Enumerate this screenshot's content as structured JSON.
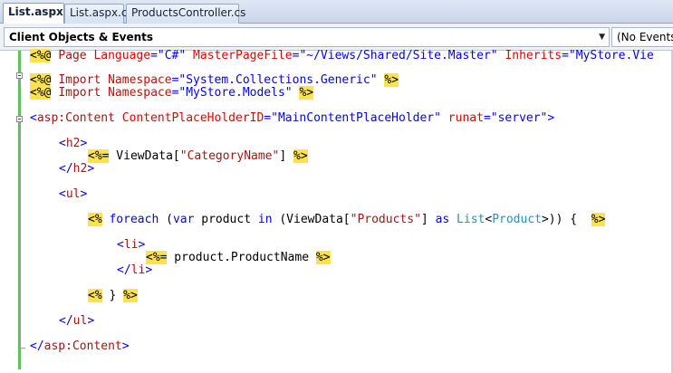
{
  "tabs": [
    {
      "label": "List.aspx",
      "active": true
    },
    {
      "label": "List.aspx.cs",
      "active": false
    },
    {
      "label": "ProductsController.cs",
      "active": false
    }
  ],
  "navbar": {
    "objects_dropdown": "Client Objects & Events",
    "events_dropdown": "(No Events)"
  },
  "colors": {
    "delimiter_highlight": "#fde34b",
    "markup_tag": "#a31515",
    "markup_attribute": "#e50000",
    "string_value": "#0000ff",
    "keyword": "#0000ff",
    "type_name": "#2b91af",
    "change_bar": "#5ec15e"
  },
  "code_lines": [
    [
      [
        "<%@",
        "dl"
      ],
      [
        " ",
        "pl"
      ],
      [
        "Page",
        "tag"
      ],
      [
        " ",
        "pl"
      ],
      [
        "Language",
        "attr"
      ],
      [
        "=\"C#\"",
        "str"
      ],
      [
        " ",
        "pl"
      ],
      [
        "MasterPageFile",
        "attr"
      ],
      [
        "=\"~/Views/Shared/Site.Master\"",
        "str"
      ],
      [
        " ",
        "pl"
      ],
      [
        "Inherits",
        "attr"
      ],
      [
        "=\"MyStore.Vie",
        "str"
      ]
    ],
    [
      [
        "<%@",
        "dl"
      ],
      [
        " ",
        "pl"
      ],
      [
        "Import",
        "tag"
      ],
      [
        " ",
        "pl"
      ],
      [
        "Namespace",
        "attr"
      ],
      [
        "=\"System.Collections.Generic\"",
        "str"
      ],
      [
        " ",
        "pl"
      ],
      [
        "%>",
        "dl"
      ]
    ],
    [
      [
        "<%@",
        "dl"
      ],
      [
        " ",
        "pl"
      ],
      [
        "Import",
        "tag"
      ],
      [
        " ",
        "pl"
      ],
      [
        "Namespace",
        "attr"
      ],
      [
        "=\"MyStore.Models\"",
        "str"
      ],
      [
        " ",
        "pl"
      ],
      [
        "%>",
        "dl"
      ]
    ],
    [
      [
        "<",
        "str"
      ],
      [
        "asp:Content",
        "tag"
      ],
      [
        " ",
        "pl"
      ],
      [
        "ContentPlaceHolderID",
        "attr"
      ],
      [
        "=\"MainContentPlaceHolder\"",
        "str"
      ],
      [
        " ",
        "pl"
      ],
      [
        "runat",
        "attr"
      ],
      [
        "=\"server\"",
        "str"
      ],
      [
        ">",
        "str"
      ]
    ],
    [
      [
        "<",
        "str"
      ],
      [
        "h2",
        "tag"
      ],
      [
        ">",
        "str"
      ]
    ],
    [
      [
        "<%=",
        "dl"
      ],
      [
        " ViewData[",
        "pl"
      ],
      [
        "\"CategoryName\"",
        "tag"
      ],
      [
        "] ",
        "pl"
      ],
      [
        "%>",
        "dl"
      ]
    ],
    [
      [
        "</",
        "str"
      ],
      [
        "h2",
        "tag"
      ],
      [
        ">",
        "str"
      ]
    ],
    [
      [
        "<",
        "str"
      ],
      [
        "ul",
        "tag"
      ],
      [
        ">",
        "str"
      ]
    ],
    [
      [
        "<%",
        "dl"
      ],
      [
        " ",
        "pl"
      ],
      [
        "foreach",
        "kw"
      ],
      [
        " (",
        "pl"
      ],
      [
        "var",
        "kw"
      ],
      [
        " product ",
        "pl"
      ],
      [
        "in",
        "kw"
      ],
      [
        " (ViewData[",
        "pl"
      ],
      [
        "\"Products\"",
        "tag"
      ],
      [
        "] ",
        "pl"
      ],
      [
        "as",
        "kw"
      ],
      [
        " ",
        "pl"
      ],
      [
        "List",
        "type"
      ],
      [
        "<",
        "pl"
      ],
      [
        "Product",
        "type"
      ],
      [
        ">)) {  ",
        "pl"
      ],
      [
        "%>",
        "dl"
      ]
    ],
    [
      [
        "<",
        "str"
      ],
      [
        "li",
        "tag"
      ],
      [
        ">",
        "str"
      ]
    ],
    [
      [
        "<%=",
        "dl"
      ],
      [
        " product.ProductName ",
        "pl"
      ],
      [
        "%>",
        "dl"
      ]
    ],
    [
      [
        "</",
        "str"
      ],
      [
        "li",
        "tag"
      ],
      [
        ">",
        "str"
      ]
    ],
    [
      [
        "<%",
        "dl"
      ],
      [
        " } ",
        "pl"
      ],
      [
        "%>",
        "dl"
      ]
    ],
    [
      [
        "</",
        "str"
      ],
      [
        "ul",
        "tag"
      ],
      [
        ">",
        "str"
      ]
    ],
    [
      [
        "</",
        "str"
      ],
      [
        "asp:Content",
        "tag"
      ],
      [
        ">",
        "str"
      ]
    ]
  ]
}
